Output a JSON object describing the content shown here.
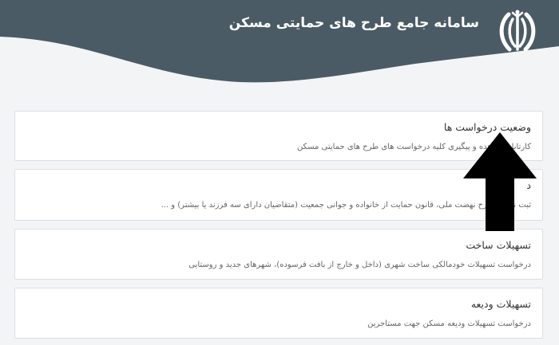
{
  "header": {
    "title": "سامانه جامع طرح های حمایتی مسکن",
    "background": "#4a5b66",
    "text_color": "#ffffff",
    "emblem_icon": "iran-emblem-icon"
  },
  "cards": [
    {
      "title": "وضعیت درخواست ها",
      "description": "کارتابل مشاهده و پیگیری کلیه درخواست های طرح های حمایتی مسکن"
    },
    {
      "title": "د",
      "description": "ثبت نام در طرح نهضت ملی، قانون حمایت از خانواده و جوانی جمعیت (متقاضیان دارای سه فرزند یا بیشتر) و ..."
    },
    {
      "title": "تسهیلات ساخت",
      "description": "درخواست تسهیلات خودمالکی ساخت شهری (داخل و خارج از بافت فرسوده)، شهرهای جدید و روستایی"
    },
    {
      "title": "تسهیلات ودیعه",
      "description": "درخواست تسهیلات ودیعه مسکن جهت مستاجرین"
    }
  ],
  "overlay": {
    "icon": "up-arrow-icon",
    "color": "#000000"
  }
}
